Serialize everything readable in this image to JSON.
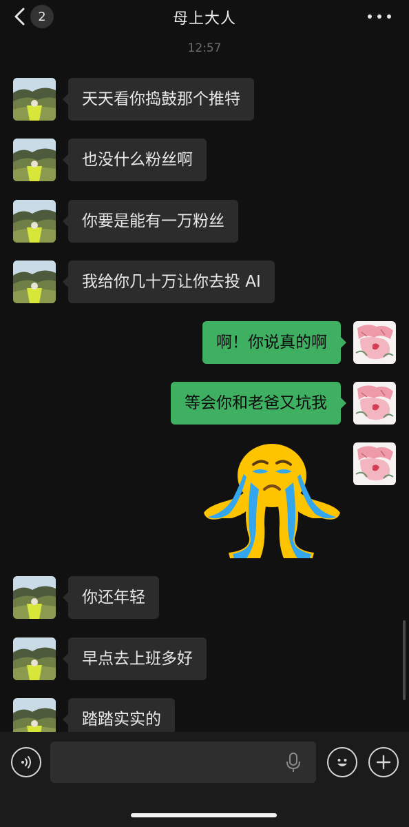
{
  "header": {
    "unread_count": "2",
    "title": "母上大人",
    "back_icon": "chevron-left-icon",
    "more_icon": "ellipsis-icon"
  },
  "timestamp": "12:57",
  "messages": [
    {
      "side": "left",
      "text": "天天看你捣鼓那个推特"
    },
    {
      "side": "left",
      "text": "也没什么粉丝啊"
    },
    {
      "side": "left",
      "text": "你要是能有一万粉丝"
    },
    {
      "side": "left",
      "text": "我给你几十万让你去投 AI"
    },
    {
      "side": "right",
      "text": "啊！你说真的啊"
    },
    {
      "side": "right",
      "text": "等会你和老爸又坑我"
    },
    {
      "side": "right",
      "type": "sticker",
      "sticker": "crying-emoji-sticker"
    },
    {
      "side": "left",
      "text": "你还年轻"
    },
    {
      "side": "left",
      "text": "早点去上班多好"
    },
    {
      "side": "left",
      "text": "踏踏实实的"
    }
  ],
  "input_bar": {
    "text": "",
    "icons": [
      "voice-icon",
      "microphone-icon",
      "emoji-icon",
      "plus-icon"
    ]
  },
  "colors": {
    "background": "#111111",
    "incoming_bubble": "#2c2c2c",
    "outgoing_bubble": "#3fb062"
  }
}
